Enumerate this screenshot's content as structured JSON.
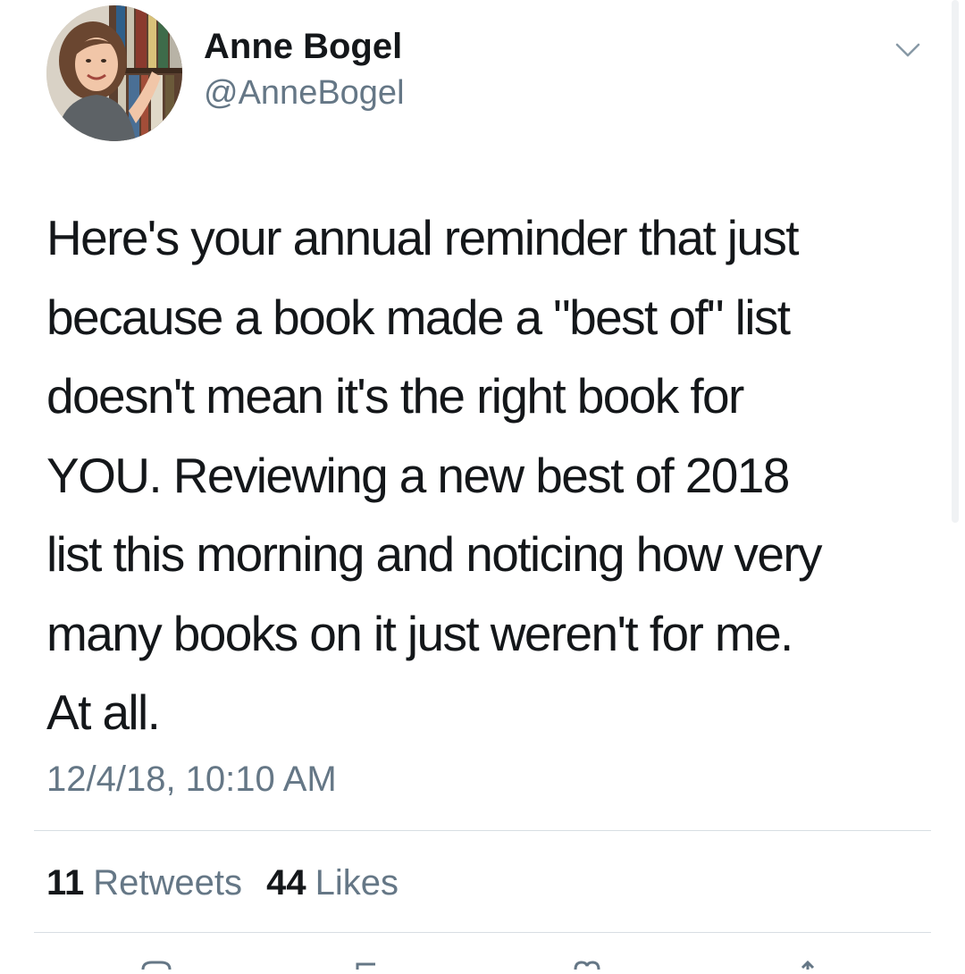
{
  "author": {
    "name": "Anne Bogel",
    "handle": "@AnneBogel"
  },
  "tweet": {
    "text": "Here's your annual reminder that just\nbecause a book made a \"best of\" list\ndoesn't mean it's the right book for\nYOU. Reviewing a new best of 2018\nlist this morning and noticing how very\nmany books on it just weren't for me.\nAt all.",
    "timestamp": "12/4/18, 10:10 AM"
  },
  "stats": {
    "retweets_count": "11",
    "retweets_label": "Retweets",
    "likes_count": "44",
    "likes_label": "Likes"
  },
  "icons": {
    "menu": "chevron-down-icon",
    "reply": "reply-icon",
    "retweet": "retweet-icon",
    "like": "heart-icon"
  },
  "colors": {
    "text": "#14171a",
    "secondary": "#657786",
    "divider": "#d8dee3"
  }
}
